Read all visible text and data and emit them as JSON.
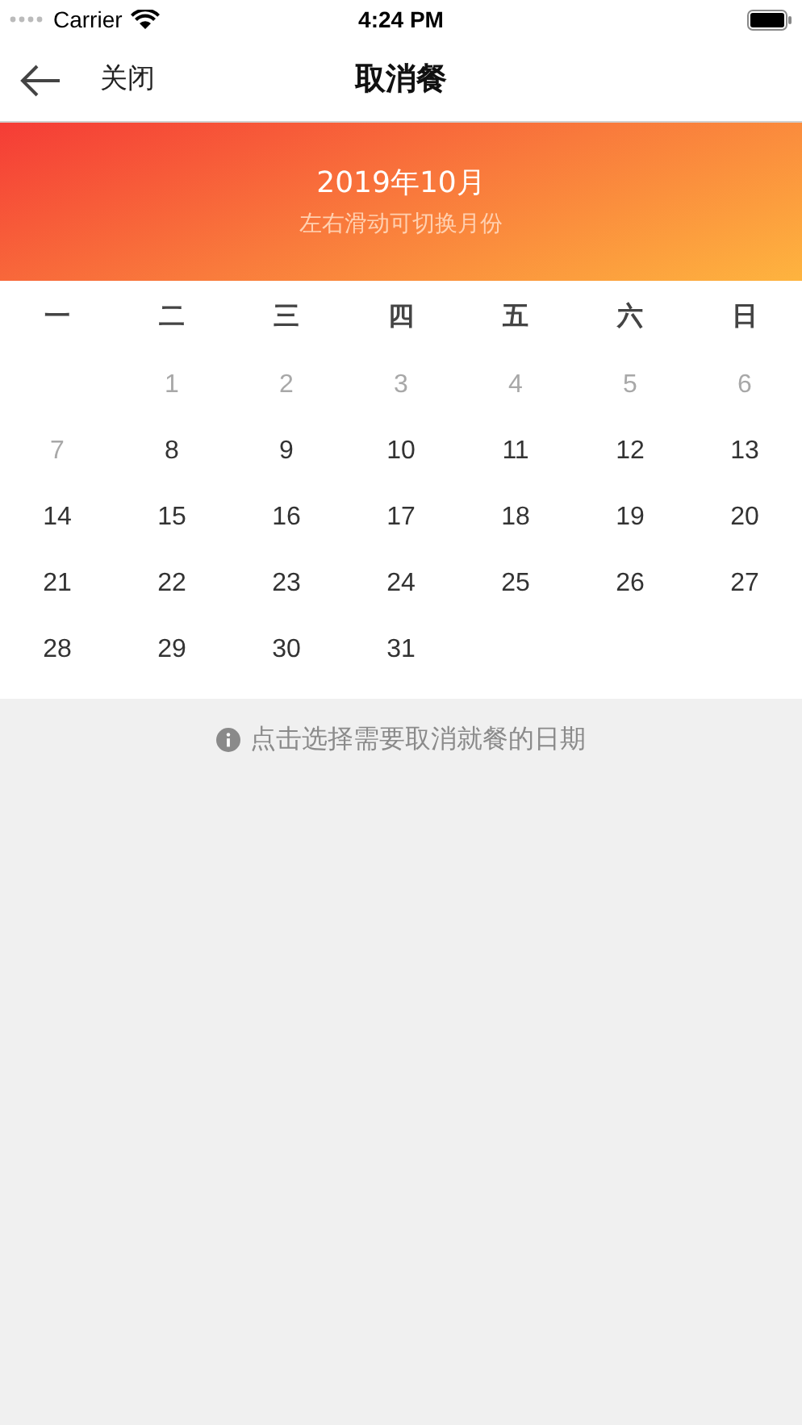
{
  "status_bar": {
    "carrier": "Carrier",
    "time": "4:24 PM"
  },
  "nav_bar": {
    "close": "关闭",
    "title": "取消餐"
  },
  "month_banner": {
    "month": "2019年10月",
    "hint": "左右滑动可切换月份"
  },
  "weekdays": [
    "一",
    "二",
    "三",
    "四",
    "五",
    "六",
    "日"
  ],
  "days": [
    {
      "kind": "blank"
    },
    {
      "kind": "day",
      "label": "1",
      "disabled": true
    },
    {
      "kind": "day",
      "label": "2",
      "disabled": true
    },
    {
      "kind": "day",
      "label": "3",
      "disabled": true
    },
    {
      "kind": "day",
      "label": "4",
      "disabled": true
    },
    {
      "kind": "day",
      "label": "5",
      "disabled": true
    },
    {
      "kind": "day",
      "label": "6",
      "disabled": true
    },
    {
      "kind": "day",
      "label": "7",
      "disabled": true
    },
    {
      "kind": "day",
      "label": "8",
      "disabled": false
    },
    {
      "kind": "day",
      "label": "9",
      "disabled": false
    },
    {
      "kind": "day",
      "label": "10",
      "disabled": false
    },
    {
      "kind": "day",
      "label": "11",
      "disabled": false
    },
    {
      "kind": "day",
      "label": "12",
      "disabled": false
    },
    {
      "kind": "day",
      "label": "13",
      "disabled": false
    },
    {
      "kind": "day",
      "label": "14",
      "disabled": false
    },
    {
      "kind": "day",
      "label": "15",
      "disabled": false
    },
    {
      "kind": "day",
      "label": "16",
      "disabled": false
    },
    {
      "kind": "day",
      "label": "17",
      "disabled": false
    },
    {
      "kind": "day",
      "label": "18",
      "disabled": false
    },
    {
      "kind": "day",
      "label": "19",
      "disabled": false
    },
    {
      "kind": "day",
      "label": "20",
      "disabled": false
    },
    {
      "kind": "day",
      "label": "21",
      "disabled": false
    },
    {
      "kind": "day",
      "label": "22",
      "disabled": false
    },
    {
      "kind": "day",
      "label": "23",
      "disabled": false
    },
    {
      "kind": "day",
      "label": "24",
      "disabled": false
    },
    {
      "kind": "day",
      "label": "25",
      "disabled": false
    },
    {
      "kind": "day",
      "label": "26",
      "disabled": false
    },
    {
      "kind": "day",
      "label": "27",
      "disabled": false
    },
    {
      "kind": "day",
      "label": "28",
      "disabled": false
    },
    {
      "kind": "day",
      "label": "29",
      "disabled": false
    },
    {
      "kind": "day",
      "label": "30",
      "disabled": false
    },
    {
      "kind": "day",
      "label": "31",
      "disabled": false
    }
  ],
  "footer_hint": "点击选择需要取消就餐的日期"
}
